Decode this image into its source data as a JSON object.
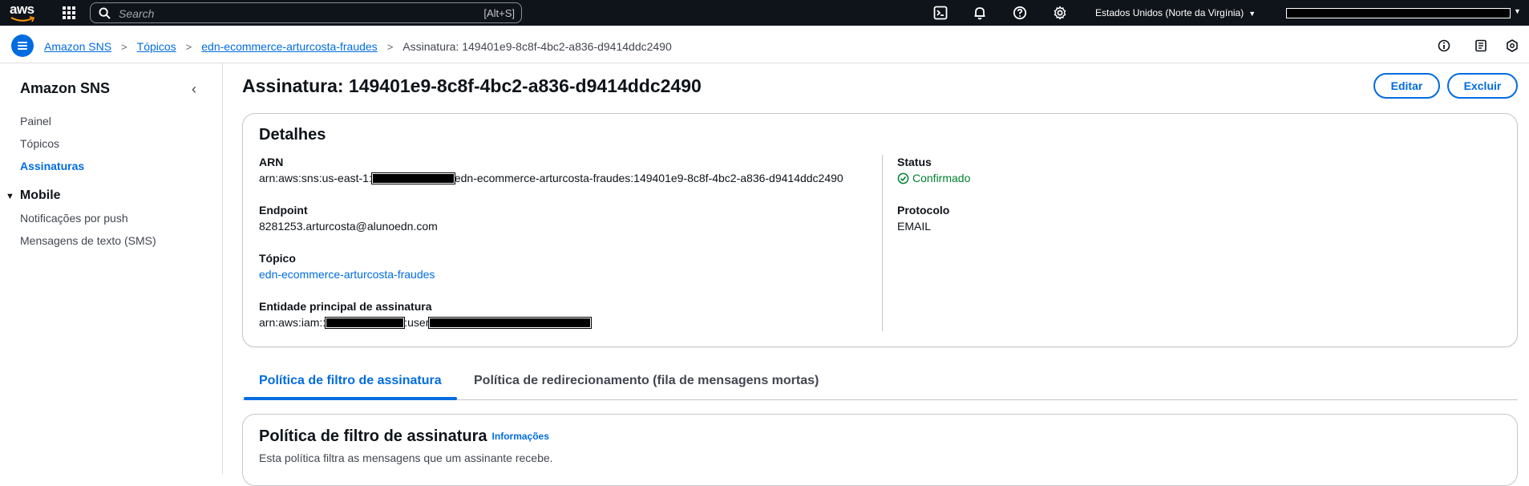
{
  "topnav": {
    "logo_text": "aws",
    "search_placeholder": "Search",
    "search_shortcut": "[Alt+S]",
    "region": "Estados Unidos (Norte da Virgínia)",
    "icons": [
      "cloudshell-icon",
      "bell-icon",
      "help-icon",
      "gear-icon"
    ]
  },
  "breadcrumb": {
    "items": [
      "Amazon SNS",
      "Tópicos",
      "edn-ecommerce-arturcosta-fraudes"
    ],
    "current": "Assinatura: 149401e9-8c8f-4bc2-a836-d9414ddc2490"
  },
  "sidebar": {
    "title": "Amazon SNS",
    "items": [
      "Painel",
      "Tópicos",
      "Assinaturas"
    ],
    "active": "Assinaturas",
    "section": "Mobile",
    "section_items": [
      "Notificações por push",
      "Mensagens de texto (SMS)"
    ]
  },
  "page": {
    "title": "Assinatura: 149401e9-8c8f-4bc2-a836-d9414ddc2490",
    "edit_button": "Editar",
    "delete_button": "Excluir"
  },
  "details": {
    "title": "Detalhes",
    "arn_label": "ARN",
    "arn_prefix": "arn:aws:sns:us-east-1:",
    "arn_suffix": "edn-ecommerce-arturcosta-fraudes:149401e9-8c8f-4bc2-a836-d9414ddc2490",
    "endpoint_label": "Endpoint",
    "endpoint_value": "8281253.arturcosta@alunoedn.com",
    "topic_label": "Tópico",
    "topic_value": "edn-ecommerce-arturcosta-fraudes",
    "principal_label": "Entidade principal de assinatura",
    "principal_prefix": "arn:aws:iam::",
    "principal_middle": ":user",
    "status_label": "Status",
    "status_value": "Confirmado",
    "protocol_label": "Protocolo",
    "protocol_value": "EMAIL"
  },
  "tabs": {
    "items": [
      "Política de filtro de assinatura",
      "Política de redirecionamento (fila de mensagens mortas)"
    ],
    "active": "Política de filtro de assinatura"
  },
  "filter_policy": {
    "title": "Política de filtro de assinatura",
    "info_link": "Informações",
    "description": "Esta política filtra as mensagens que um assinante recebe."
  },
  "colors": {
    "nav_bg": "#0f141a",
    "link_blue": "#006ce0",
    "success_green": "#00802f",
    "border": "#c6c6cd"
  }
}
